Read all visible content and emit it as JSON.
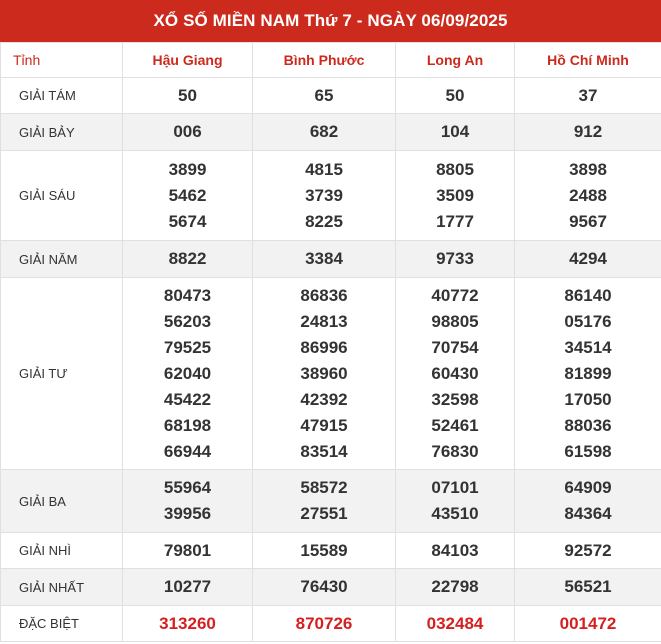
{
  "title": "XỔ SỐ MIỀN NAM Thứ 7 - NGÀY 06/09/2025",
  "header": {
    "province_label": "Tỉnh",
    "provinces": [
      "Hậu Giang",
      "Bình Phước",
      "Long An",
      "Hồ Chí Minh"
    ]
  },
  "prizes": [
    {
      "label": "GIẢI TÁM",
      "values": [
        [
          "50"
        ],
        [
          "65"
        ],
        [
          "50"
        ],
        [
          "37"
        ]
      ]
    },
    {
      "label": "GIẢI BẢY",
      "values": [
        [
          "006"
        ],
        [
          "682"
        ],
        [
          "104"
        ],
        [
          "912"
        ]
      ]
    },
    {
      "label": "GIẢI SÁU",
      "values": [
        [
          "3899",
          "5462",
          "5674"
        ],
        [
          "4815",
          "3739",
          "8225"
        ],
        [
          "8805",
          "3509",
          "1777"
        ],
        [
          "3898",
          "2488",
          "9567"
        ]
      ]
    },
    {
      "label": "GIẢI NĂM",
      "values": [
        [
          "8822"
        ],
        [
          "3384"
        ],
        [
          "9733"
        ],
        [
          "4294"
        ]
      ]
    },
    {
      "label": "GIẢI TƯ",
      "values": [
        [
          "80473",
          "56203",
          "79525",
          "62040",
          "45422",
          "68198",
          "66944"
        ],
        [
          "86836",
          "24813",
          "86996",
          "38960",
          "42392",
          "47915",
          "83514"
        ],
        [
          "40772",
          "98805",
          "70754",
          "60430",
          "32598",
          "52461",
          "76830"
        ],
        [
          "86140",
          "05176",
          "34514",
          "81899",
          "17050",
          "88036",
          "61598"
        ]
      ]
    },
    {
      "label": "GIẢI BA",
      "values": [
        [
          "55964",
          "39956"
        ],
        [
          "58572",
          "27551"
        ],
        [
          "07101",
          "43510"
        ],
        [
          "64909",
          "84364"
        ]
      ]
    },
    {
      "label": "GIẢI NHÌ",
      "values": [
        [
          "79801"
        ],
        [
          "15589"
        ],
        [
          "84103"
        ],
        [
          "92572"
        ]
      ]
    },
    {
      "label": "GIẢI NHẤT",
      "values": [
        [
          "10277"
        ],
        [
          "76430"
        ],
        [
          "22798"
        ],
        [
          "56521"
        ]
      ]
    },
    {
      "label": "ĐẶC BIỆT",
      "values": [
        [
          "313260"
        ],
        [
          "870726"
        ],
        [
          "032484"
        ],
        [
          "001472"
        ]
      ]
    }
  ],
  "colors": {
    "accent": "#cc2a1d",
    "special_number": "#d42020",
    "alt_row": "#f2f2f2"
  }
}
